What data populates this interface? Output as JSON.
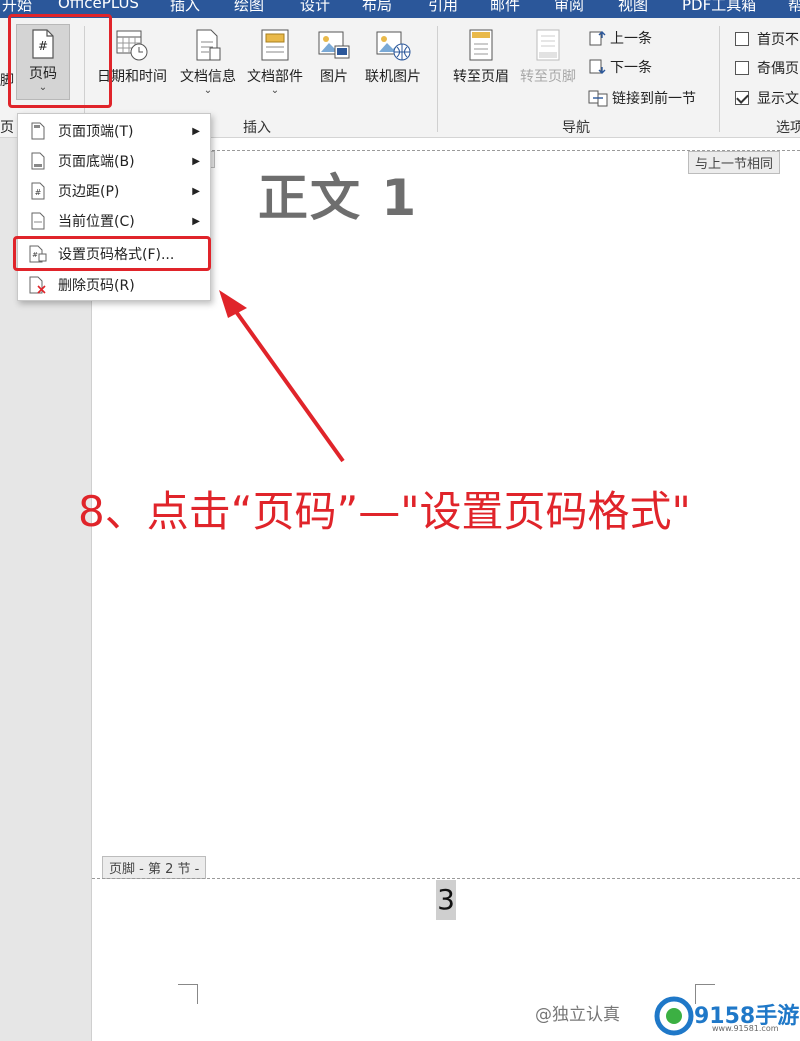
{
  "tabs": [
    "开始",
    "OfficePLUS",
    "插入",
    "绘图",
    "设计",
    "布局",
    "引用",
    "邮件",
    "审阅",
    "视图",
    "PDF工具箱",
    "帮"
  ],
  "ribbon": {
    "left_partial_label": "脚",
    "left_partial_group": "页",
    "page_number_button": "页码",
    "date_time_button": "日期和时间",
    "doc_info_button": "文档信息",
    "doc_parts_button": "文档部件",
    "picture_button": "图片",
    "online_picture_button": "联机图片",
    "insert_group": "插入",
    "goto_header_button": "转至页眉",
    "goto_footer_button": "转至页脚",
    "prev_button": "上一条",
    "next_button": "下一条",
    "link_prev_button": "链接到前一节",
    "nav_group": "导航",
    "option_first_page": "首页不",
    "option_odd_even": "奇偶页",
    "option_show_doc": "显示文",
    "options_group": "选项",
    "show_doc_checked": true
  },
  "menu": {
    "items": [
      {
        "label": "页面顶端(T)",
        "has_submenu": true
      },
      {
        "label": "页面底端(B)",
        "has_submenu": true
      },
      {
        "label": "页边距(P)",
        "has_submenu": true
      },
      {
        "label": "当前位置(C)",
        "has_submenu": true
      },
      {
        "label": "设置页码格式(F)...",
        "has_submenu": false
      },
      {
        "label": "删除页码(R)",
        "has_submenu": false
      }
    ]
  },
  "document": {
    "header_tag": "-",
    "same_as_prev_tag": "与上一节相同",
    "body_title": "正文 1",
    "footer_tag": "页脚 - 第 2 节 -",
    "page_number": "3"
  },
  "annotation": "8、点击“页码”—\"设置页码格式\"",
  "watermark": "@独立认真",
  "logo": {
    "text": "9158手游",
    "sub": "www.91581.com"
  },
  "colors": {
    "accent_red": "#e0242a",
    "tab_blue": "#2b579a",
    "logo_blue": "#1f78c8"
  }
}
